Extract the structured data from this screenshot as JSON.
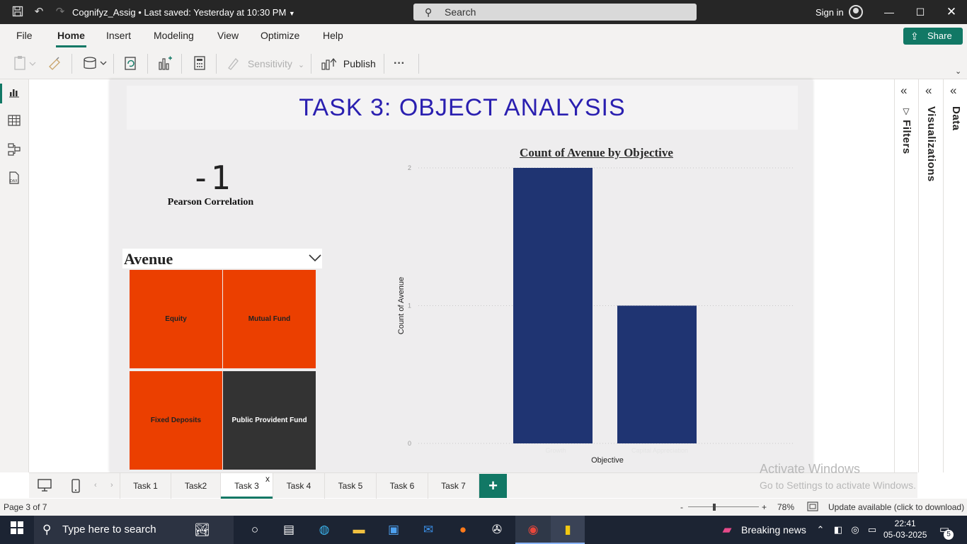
{
  "titlebar": {
    "doc_title": "Cognifyz_Assig • Last saved: Yesterday at 10:30 PM",
    "search_placeholder": "Search",
    "signin": "Sign in"
  },
  "menu": {
    "tabs": [
      "File",
      "Home",
      "Insert",
      "Modeling",
      "View",
      "Optimize",
      "Help"
    ],
    "active": "Home",
    "share": "Share"
  },
  "ribbon": {
    "sensitivity": "Sensitivity",
    "publish": "Publish",
    "more": "···"
  },
  "report": {
    "title": "TASK 3: OBJECT ANALYSIS",
    "card": {
      "value": "-1",
      "label": "Pearson Correlation"
    },
    "slicer": {
      "title": "Avenue",
      "items": [
        {
          "label": "Equity",
          "color": "#eb3f00",
          "text_color": "#222222"
        },
        {
          "label": "Mutual Fund",
          "color": "#eb3f00",
          "text_color": "#222222"
        },
        {
          "label": "Fixed Deposits",
          "color": "#eb3f00",
          "text_color": "#222222"
        },
        {
          "label": "Public Provident Fund",
          "color": "#333333",
          "text_color": "#ffffff"
        }
      ]
    }
  },
  "chart_data": {
    "type": "bar",
    "title": "Count of Avenue by Objective",
    "xlabel": "Objective",
    "ylabel": "Count of Avenue",
    "categories": [
      "Growth",
      "Capital Appreciation"
    ],
    "values": [
      2,
      1
    ],
    "ylim": [
      0,
      2
    ],
    "yticks": [
      0,
      1,
      2
    ],
    "grid": true,
    "bar_color": "#1f3472"
  },
  "panes": {
    "filters": "Filters",
    "visualizations": "Visualizations",
    "data": "Data"
  },
  "page_tabs": {
    "tabs": [
      "Task 1",
      "Task2",
      "Task 3",
      "Task 4",
      "Task 5",
      "Task 6",
      "Task 7"
    ],
    "active": "Task 3",
    "close": "x",
    "add": "+"
  },
  "watermark": {
    "line1": "Activate Windows",
    "line2": "Go to Settings to activate Windows."
  },
  "statusbar": {
    "page": "Page 3 of 7",
    "zoom": "78%",
    "zoom_minus": "-",
    "zoom_plus": "+",
    "update": "Update available (click to download)"
  },
  "taskbar": {
    "search_placeholder": "Type here to search",
    "news": "Breaking news",
    "time": "22:41",
    "date": "05-03-2025",
    "notifications": "5"
  }
}
